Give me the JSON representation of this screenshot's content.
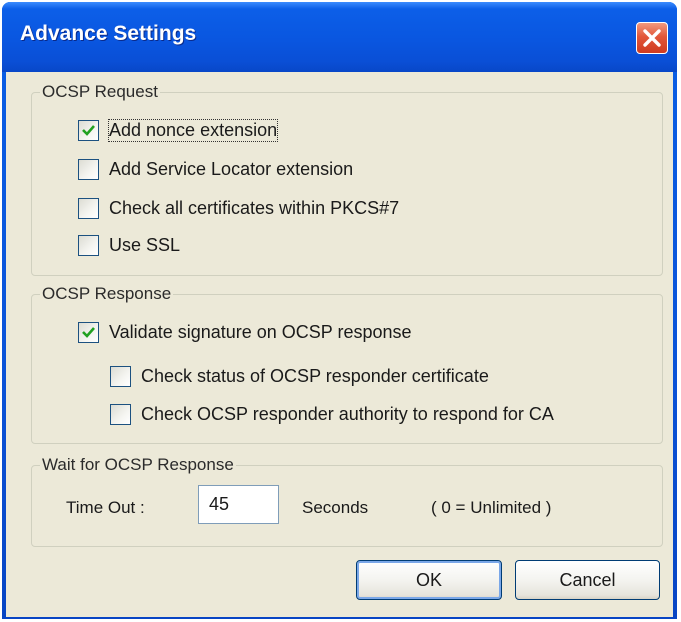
{
  "window": {
    "title": "Advance Settings",
    "close_icon": "close-icon"
  },
  "ocsp_request": {
    "legend": "OCSP Request",
    "items": [
      {
        "label": "Add nonce extension",
        "checked": true
      },
      {
        "label": "Add Service Locator extension",
        "checked": false
      },
      {
        "label": "Check all certificates within PKCS#7",
        "checked": false
      },
      {
        "label": "Use SSL",
        "checked": false
      }
    ]
  },
  "ocsp_response": {
    "legend": "OCSP Response",
    "validate_label": "Validate signature on OCSP response",
    "validate_checked": true,
    "check_status_label": "Check status of OCSP responder certificate",
    "check_status_checked": false,
    "check_authority_label": "Check OCSP responder authority to respond for CA",
    "check_authority_checked": false
  },
  "wait": {
    "legend": "Wait for OCSP Response",
    "timeout_label": "Time Out :",
    "timeout_value": "45",
    "seconds_label": "Seconds",
    "unlimited_note": "( 0 = Unlimited )"
  },
  "buttons": {
    "ok": "OK",
    "cancel": "Cancel"
  },
  "colors": {
    "titlebar": "#0a56e0",
    "client_bg": "#ece9d8",
    "check_green": "#21a121",
    "close_red": "#e2573a"
  }
}
